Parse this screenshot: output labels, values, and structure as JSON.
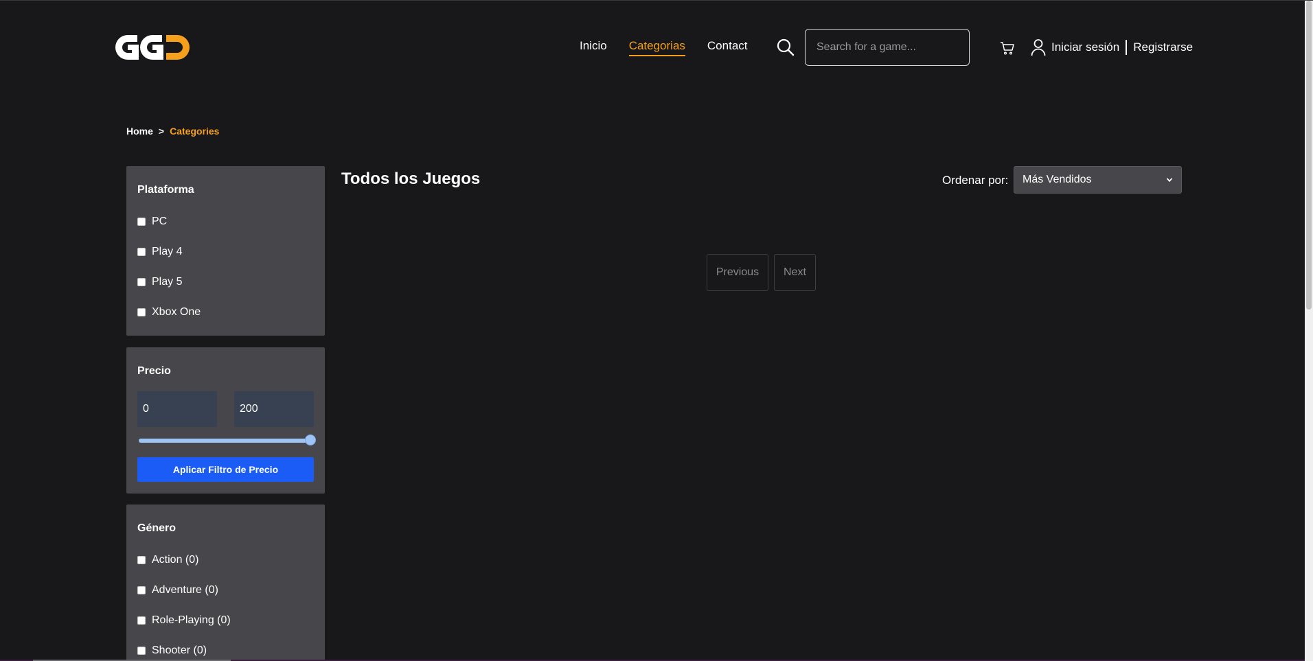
{
  "header": {
    "logo_text": "GG",
    "nav": [
      {
        "label": "Inicio",
        "active": false
      },
      {
        "label": "Categorias",
        "active": true
      },
      {
        "label": "Contact",
        "active": false
      }
    ],
    "search": {
      "placeholder": "Search for a game...",
      "value": ""
    },
    "auth": {
      "login_label": "Iniciar sesión",
      "register_label": "Registrarse"
    }
  },
  "breadcrumb": {
    "home": "Home",
    "separator": ">",
    "current": "Categories"
  },
  "sidebar": {
    "platform": {
      "title": "Plataforma",
      "items": [
        "PC",
        "Play 4",
        "Play 5",
        "Xbox One"
      ]
    },
    "price": {
      "title": "Precio",
      "min_value": "0",
      "max_value": "200",
      "slider_level": 1.0,
      "apply_label": "Aplicar Filtro de Precio"
    },
    "genre": {
      "title": "Género",
      "items": [
        "Action (0)",
        "Adventure (0)",
        "Role-Playing (0)",
        "Shooter (0)"
      ]
    }
  },
  "main": {
    "title": "Todos los Juegos",
    "sort": {
      "label": "Ordenar por:",
      "selected": "Más Vendidos"
    },
    "pagination": {
      "previous": "Previous",
      "next": "Next"
    }
  },
  "colors": {
    "background": "#18181b",
    "panel": "#47474b",
    "accent": "#f5a01d",
    "primary_button": "#1a5cf5",
    "input_bg": "#374151"
  }
}
